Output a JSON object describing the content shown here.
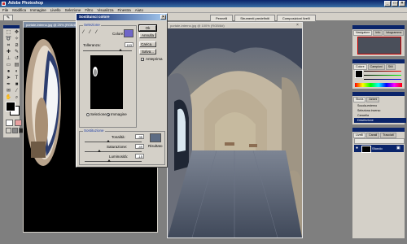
{
  "window": {
    "title": "Adobe Photoshop"
  },
  "menu": [
    "File",
    "Modifica",
    "Immagine",
    "Livello",
    "Selezione",
    "Filtro",
    "Visualizza",
    "Finestra",
    "Aiuto"
  ],
  "palette_tabs": [
    "Pennelli",
    "Strumenti predefiniti",
    "Composizioni livelli"
  ],
  "left_doc": {
    "title": "portale-interno.jpg @ 25% (RGB/8)"
  },
  "photo_doc": {
    "title": "portale-interno.jpg @ 100% (RGB/8#)"
  },
  "dialog": {
    "title": "Sostituisci colore",
    "selection_group": "Selezione",
    "color_label": "Colore:",
    "tolerance_label": "Tolleranza:",
    "tolerance_value": "153",
    "tolerance_level": 0.76,
    "radio_selection": "Selezione",
    "radio_image": "Immagine",
    "replacement_group": "Sostituzione",
    "hue_label": "Tonalità:",
    "hue_value": "-35",
    "hue_level": 0.41,
    "saturation_label": "Saturazione:",
    "saturation_value": "-49",
    "saturation_level": 0.26,
    "lightness_label": "Luminosità:",
    "lightness_value": "-15",
    "lightness_level": 0.43,
    "result_label": "Risultato",
    "ok": "Ok",
    "cancel": "Annulla",
    "load": "Carica...",
    "save": "Salva...",
    "preview": "Anteprima",
    "selection_color": "#6f66c8",
    "result_color": "#5d6c84"
  },
  "navigator": {
    "tabs": [
      "Navigatore",
      "Info",
      "Istogramma"
    ]
  },
  "color_palette": {
    "tabs": [
      "Colore",
      "Campioni",
      "Stili"
    ]
  },
  "history": {
    "tabs": [
      "Storia",
      "Azioni"
    ],
    "items": [
      "Scuola-esterno",
      "Seleziona inverso",
      "Cancella",
      "Deselezione"
    ]
  },
  "layers": {
    "tabs": [
      "Livelli",
      "Canali",
      "Tracciati"
    ],
    "layer_name": "Sfondo"
  }
}
